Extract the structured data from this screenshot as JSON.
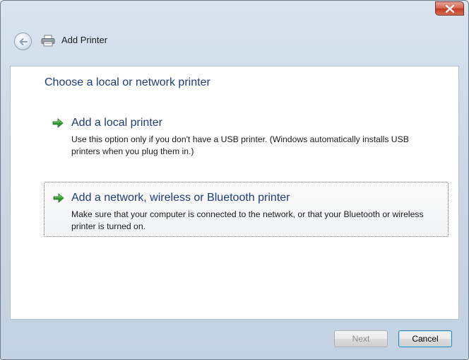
{
  "window": {
    "title": "Add Printer",
    "icons": {
      "back": "back-arrow-icon",
      "app": "printer-icon",
      "close": "close-icon"
    },
    "colors": {
      "heading": "#1c3d78",
      "accent_arrow": "#2d9a2a",
      "close": "#c23a22"
    }
  },
  "main": {
    "heading": "Choose a local or network printer",
    "options": [
      {
        "title": "Add a local printer",
        "description": "Use this option only if you don't have a USB printer. (Windows automatically installs USB printers when you plug them in.)",
        "icon": "green-arrow-icon"
      },
      {
        "title": "Add a network, wireless or Bluetooth printer",
        "description": "Make sure that your computer is connected to the network, or that your Bluetooth or wireless printer is turned on.",
        "icon": "green-arrow-icon"
      }
    ]
  },
  "footer": {
    "next_label": "Next",
    "cancel_label": "Cancel"
  }
}
